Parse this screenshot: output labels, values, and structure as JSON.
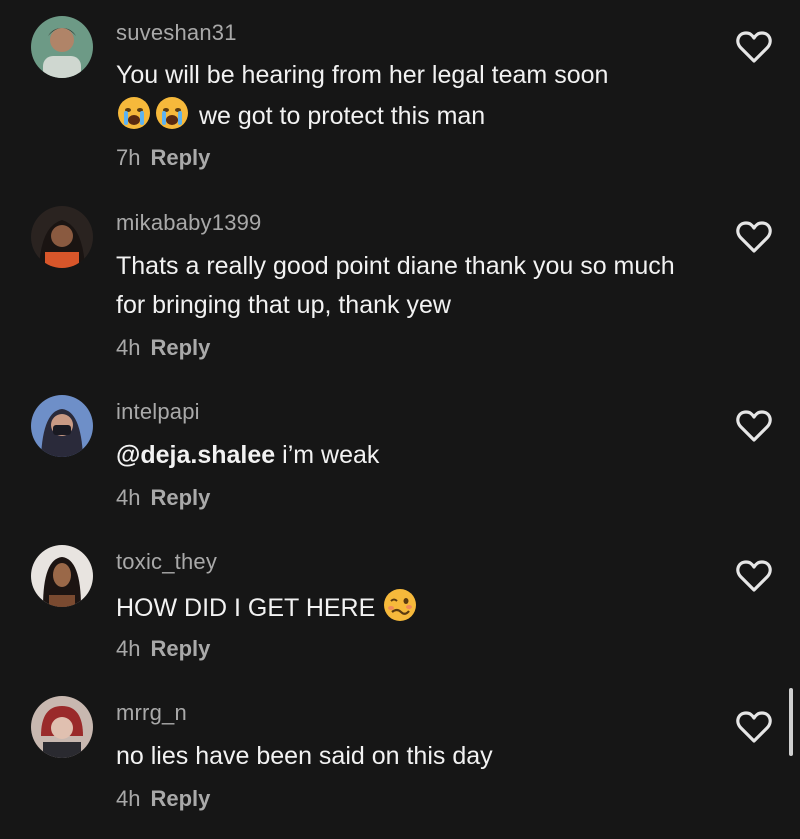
{
  "comments": [
    {
      "username": "suveshan31",
      "text_before": "You will be hearing from her legal team soon",
      "emojis": [
        "loudly-crying-face",
        "loudly-crying-face"
      ],
      "text_after": "we got to protect this man",
      "time": "7h",
      "reply": "Reply"
    },
    {
      "username": "mikababy1399",
      "text": "Thats a really good point diane thank you so much for bringing that up, thank yew",
      "time": "4h",
      "reply": "Reply"
    },
    {
      "username": "intelpapi",
      "mention": "@deja.shalee",
      "text": "i’m weak",
      "time": "4h",
      "reply": "Reply"
    },
    {
      "username": "toxic_they",
      "text": "HOW DID I GET HERE",
      "emojis": [
        "woozy-face"
      ],
      "time": "4h",
      "reply": "Reply"
    },
    {
      "username": "mrrg_n",
      "text": "no lies have been said on this day",
      "time": "4h",
      "reply": "Reply"
    }
  ],
  "icons": {
    "like": "heart-outline-icon"
  },
  "colors": {
    "background": "#161616",
    "username": "#a9a9a9",
    "text": "#f2f2f2",
    "emoji": "#f6b93b"
  }
}
